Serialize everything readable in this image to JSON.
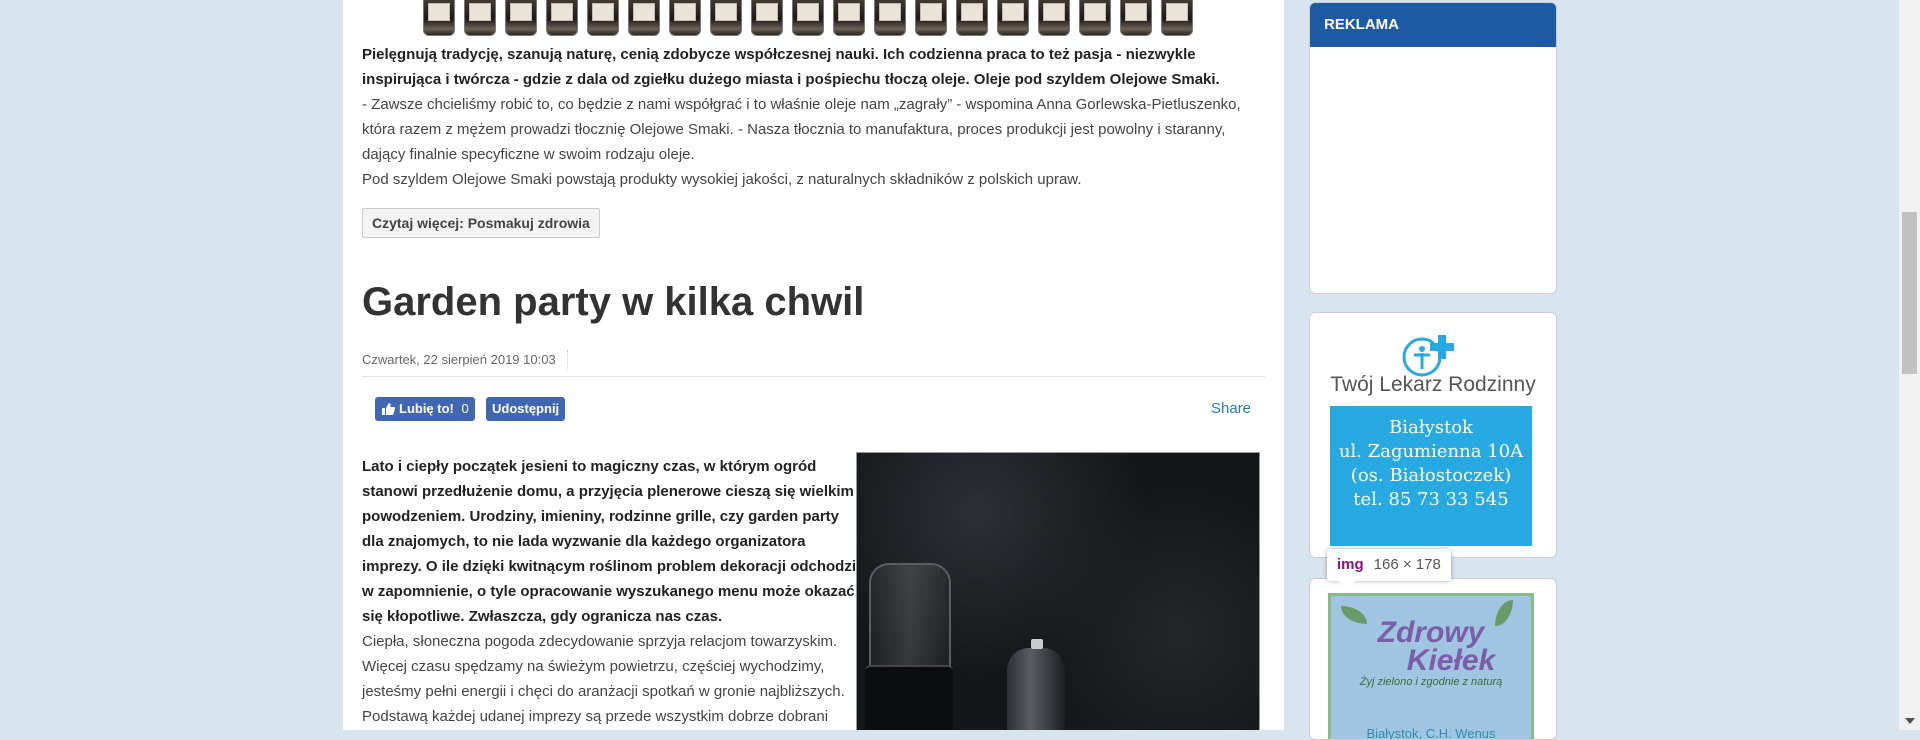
{
  "article_prev": {
    "lead": "Pielęgnują tradycję, szanują naturę, cenią zdobycze współczesnej nauki. Ich codzienna praca to też pasja - niezwykle inspirująca i twórcza - gdzie z dala od zgiełku dużego miasta i pośpiechu tłoczą oleje. Oleje pod szyldem Olejowe Smaki.",
    "para1": "- Zawsze chcieliśmy robić to, co będzie z nami współgrać i to właśnie oleje nam „zagrały” - wspomina Anna Gorlewska-Pietluszenko, która razem z mężem prowadzi tłocznię Olejowe Smaki. - Nasza tłocznia to manufaktura, proces produkcji jest powolny i staranny, dający finalnie specyficzne w swoim rodzaju oleje.",
    "para2": "Pod szyldem Olejowe Smaki powstają produkty wysokiej jakości, z naturalnych składników z polskich upraw.",
    "read_more": "Czytaj więcej: Posmakuj zdrowia"
  },
  "article": {
    "title": "Garden party w kilka chwil",
    "date": "Czwartek, 22 sierpień 2019 10:03",
    "like_label": "Lubię to!",
    "like_count": "0",
    "share_fb": "Udostępnij",
    "share_link": "Share",
    "lead": "Lato i ciepły początek jesieni to magiczny czas, w którym ogród stanowi przedłużenie domu, a przyjęcia plenerowe cieszą się wielkim powodzeniem. Urodziny, imieniny, rodzinne grille, czy garden party dla znajomych, to nie lada wyzwanie dla każdego organizatora imprezy. O ile dzięki kwitnącym roślinom problem dekoracji odchodzi w zapomnienie, o tyle opracowanie wyszukanego menu może okazać się kłopotliwe. Zwłaszcza, gdy ogranicza nas czas.",
    "body": "Ciepła, słoneczna pogoda zdecydowanie sprzyja relacjom towarzyskim. Więcej czasu spędzamy na świeżym powietrzu, częściej wychodzimy, jesteśmy pełni energii i chęci do aranżacji spotkań w gronie najbliższych. Podstawą każdej udanej imprezy są przede wszystkim dobrze dobrani"
  },
  "sidebar": {
    "reklama_title": "REKLAMA",
    "ad1": {
      "name": "Twój Lekarz Rodzinny",
      "city": "Białystok",
      "street": "ul. Zagumienna 10A",
      "district": "(os. Białostoczek)",
      "phone": "tel. 85 73 33 545"
    },
    "ad2": {
      "title1": "Zdrowy",
      "title2": "Kiełek",
      "slogan": "Żyj zielono i zgodnie z naturą",
      "bottom": "Białystok, C.H. Wenus"
    }
  },
  "tooltip": {
    "tag": "img",
    "dims": "166 × 178"
  },
  "colors": {
    "brand_blue": "#1d5aa4",
    "facebook": "#4267b2",
    "link": "#2a7ab9",
    "ad_cyan": "#27a9e1"
  }
}
